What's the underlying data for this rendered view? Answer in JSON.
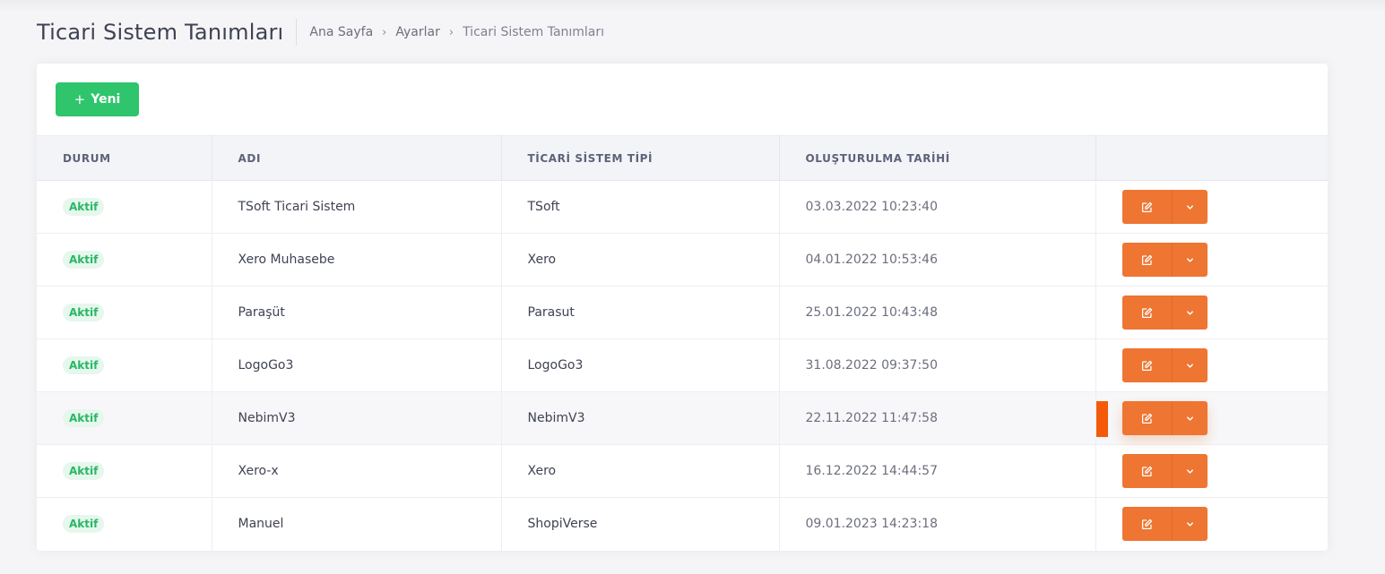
{
  "page": {
    "title": "Ticari Sistem Tanımları",
    "breadcrumb": [
      "Ana Sayfa",
      "Ayarlar",
      "Ticari Sistem Tanımları"
    ]
  },
  "toolbar": {
    "new_label": "Yeni"
  },
  "table": {
    "columns": [
      "DURUM",
      "ADI",
      "TİCARİ SİSTEM TİPİ",
      "OLUŞTURULMA TARİHİ",
      ""
    ],
    "rows": [
      {
        "status": "Aktif",
        "name": "TSoft Ticari Sistem",
        "type": "TSoft",
        "created": "03.03.2022 10:23:40"
      },
      {
        "status": "Aktif",
        "name": "Xero Muhasebe",
        "type": "Xero",
        "created": "04.01.2022 10:53:46"
      },
      {
        "status": "Aktif",
        "name": "Paraşüt",
        "type": "Parasut",
        "created": "25.01.2022 10:43:48"
      },
      {
        "status": "Aktif",
        "name": "LogoGo3",
        "type": "LogoGo3",
        "created": "31.08.2022 09:37:50"
      },
      {
        "status": "Aktif",
        "name": "NebimV3",
        "type": "NebimV3",
        "created": "22.11.2022 11:47:58"
      },
      {
        "status": "Aktif",
        "name": "Xero-x",
        "type": "Xero",
        "created": "16.12.2022 14:44:57"
      },
      {
        "status": "Aktif",
        "name": "Manuel",
        "type": "ShopiVerse",
        "created": "09.01.2023 14:23:18"
      }
    ]
  },
  "colors": {
    "accent_green": "#2ec56c",
    "action_orange": "#ee7532",
    "badge_bg": "#e6f7ed",
    "badge_text": "#29b765"
  },
  "icons": {
    "new": "plus-icon",
    "edit": "edit-icon",
    "dropdown": "chevron-down-icon",
    "breadcrumb_separator": "chevron-right-icon"
  }
}
